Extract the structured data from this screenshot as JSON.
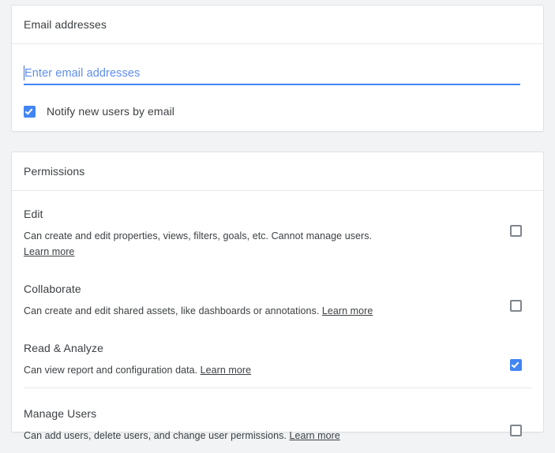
{
  "colors": {
    "page_background": "#f1f3f4",
    "card_background": "#ffffff",
    "accent_blue": "#4285f4",
    "placeholder_blue": "#5d8df4",
    "text_primary": "#3c4043",
    "border": "#dfe1e5",
    "checkbox_unchecked_border": "#80868b"
  },
  "email_card": {
    "header_title": "Email addresses",
    "input": {
      "placeholder": "Enter email addresses",
      "value": ""
    },
    "notify_checkbox": {
      "label": "Notify new users by email",
      "checked": true
    }
  },
  "permissions_card": {
    "header_title": "Permissions",
    "learn_more_label": "Learn more",
    "rows": [
      {
        "title": "Edit",
        "description": "Can create and edit properties, views, filters, goals, etc. Cannot manage users.",
        "learn_more": "Learn more",
        "learn_more_on_new_line": true,
        "checked": false
      },
      {
        "title": "Collaborate",
        "description": "Can create and edit shared assets, like dashboards or annotations.",
        "learn_more": "Learn more",
        "learn_more_on_new_line": false,
        "checked": false
      },
      {
        "title": "Read & Analyze",
        "description": "Can view report and configuration data.",
        "learn_more": "Learn more",
        "learn_more_on_new_line": false,
        "checked": true
      },
      {
        "title": "Manage Users",
        "description": "Can add users, delete users, and change user permissions.",
        "learn_more": "Learn more",
        "learn_more_on_new_line": false,
        "checked": false
      }
    ]
  }
}
